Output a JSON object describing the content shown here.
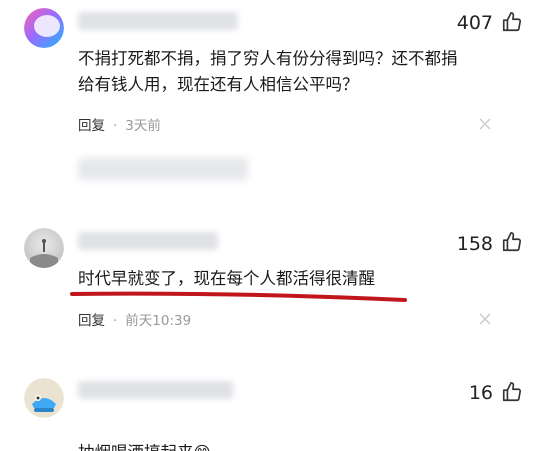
{
  "comments": [
    {
      "likes": "407",
      "text": "不捐打死都不捐，捐了穷人有份分得到吗？还不都捐\n给有钱人用，现在还有人相信公平吗？",
      "reply_label": "回复",
      "dot": "·",
      "time": "3天前"
    },
    {
      "likes": "158",
      "text": "时代早就变了，现在每个人都活得很清醒",
      "reply_label": "回复",
      "dot": "·",
      "time": "前天10:39"
    },
    {
      "likes": "16",
      "text": "抽烟喝酒搞起来",
      "emoji": "😁"
    }
  ],
  "colors": {
    "underline": "#c0161c",
    "muted": "#999999",
    "text": "#1a1a1a"
  },
  "icons": [
    "thumbs-up-icon",
    "close-icon",
    "grin-emoji-icon"
  ]
}
